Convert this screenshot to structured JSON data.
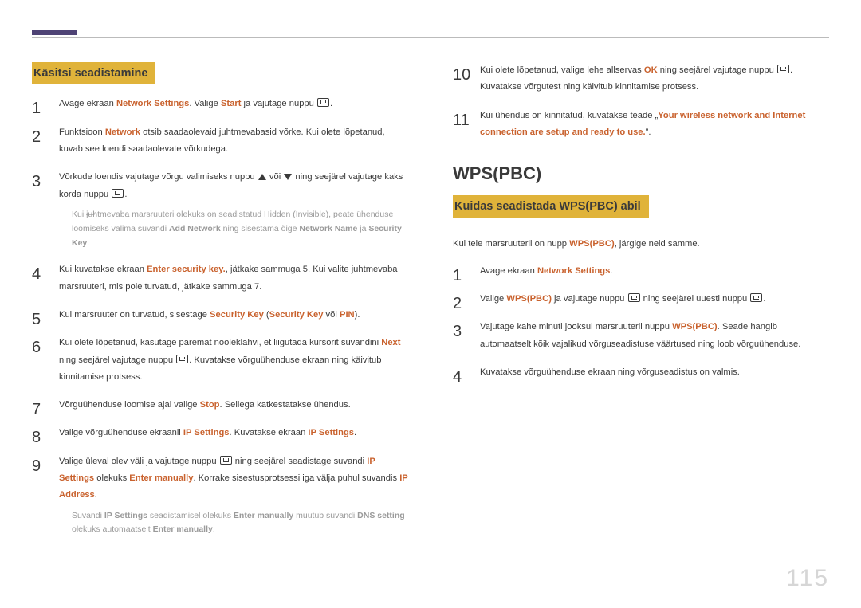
{
  "page_number": "115",
  "left": {
    "section_title": "Käsitsi seadistamine",
    "steps": {
      "s1_a": "Avage ekraan ",
      "s1_b": "Network Settings",
      "s1_c": ". Valige ",
      "s1_d": "Start",
      "s1_e": " ja vajutage nuppu ",
      "s1_f": ".",
      "s2_a": "Funktsioon ",
      "s2_b": "Network",
      "s2_c": " otsib saadaolevaid juhtmevabasid võrke. Kui olete lõpetanud, kuvab see loendi saadaolevate võrkudega.",
      "s3_a": "Võrkude loendis vajutage võrgu valimiseks nuppu ",
      "s3_b": " või ",
      "s3_c": " ning seejärel vajutage kaks korda nuppu ",
      "s3_d": ".",
      "note1_a": "Kui juhtmevaba marsruuteri olekuks on seadistatud Hidden (Invisible), peate ühenduse loomiseks valima suvandi ",
      "note1_b": "Add Network",
      "note1_c": " ning sisestama õige ",
      "note1_d": "Network Name",
      "note1_e": " ja ",
      "note1_f": "Security Key",
      "note1_g": ".",
      "s4_a": "Kui kuvatakse ekraan ",
      "s4_b": "Enter security key.",
      "s4_c": ", jätkake sammuga 5. Kui valite juhtmevaba marsruuteri, mis pole turvatud, jätkake sammuga 7.",
      "s5_a": "Kui marsruuter on turvatud, sisestage ",
      "s5_b": "Security Key",
      "s5_c": " (",
      "s5_d": "Security Key",
      "s5_e": " või ",
      "s5_f": "PIN",
      "s5_g": ").",
      "s6_a": "Kui olete lõpetanud, kasutage paremat nooleklahvi, et liigutada kursorit suvandini ",
      "s6_b": "Next",
      "s6_c": " ning seejärel vajutage nuppu ",
      "s6_d": ". Kuvatakse võrguühenduse ekraan ning käivitub kinnitamise protsess.",
      "s7_a": "Võrguühenduse loomise ajal valige ",
      "s7_b": "Stop",
      "s7_c": ". Sellega katkestatakse ühendus.",
      "s8_a": "Valige võrguühenduse ekraanil ",
      "s8_b": "IP Settings",
      "s8_c": ". Kuvatakse ekraan ",
      "s8_d": "IP Settings",
      "s8_e": ".",
      "s9_a": "Valige üleval olev väli ja vajutage nuppu ",
      "s9_b": " ning seejärel seadistage suvandi ",
      "s9_c": "IP Settings",
      "s9_d": " olekuks ",
      "s9_e": "Enter manually",
      "s9_f": ". Korrake sisestusprotsessi iga välja puhul suvandis ",
      "s9_g": "IP Address",
      "s9_h": ".",
      "note2_a": "Suvandi ",
      "note2_b": "IP Settings",
      "note2_c": " seadistamisel olekuks ",
      "note2_d": "Enter manually",
      "note2_e": " muutub suvandi ",
      "note2_f": "DNS setting",
      "note2_g": " olekuks automaatselt ",
      "note2_h": "Enter manually",
      "note2_i": "."
    }
  },
  "right": {
    "cont": {
      "s10_a": "Kui olete lõpetanud, valige lehe allservas ",
      "s10_b": "OK",
      "s10_c": " ning seejärel vajutage nuppu ",
      "s10_d": ". Kuvatakse võrgutest ning käivitub kinnitamise protsess.",
      "s11_a": "Kui ühendus on kinnitatud, kuvatakse teade „",
      "s11_b": "Your wireless network and Internet connection are setup and ready to use.",
      "s11_c": "”."
    },
    "h1": "WPS(PBC)",
    "section_title": "Kuidas seadistada WPS(PBC) abil",
    "intro_a": "Kui teie marsruuteril on nupp ",
    "intro_b": "WPS(PBC)",
    "intro_c": ", järgige neid samme.",
    "steps": {
      "s1_a": "Avage ekraan ",
      "s1_b": "Network Settings",
      "s1_c": ".",
      "s2_a": "Valige ",
      "s2_b": "WPS(PBC)",
      "s2_c": " ja vajutage nuppu ",
      "s2_d": " ning seejärel uuesti nuppu ",
      "s2_e": ".",
      "s3_a": "Vajutage kahe minuti jooksul marsruuteril nuppu ",
      "s3_b": "WPS(PBC)",
      "s3_c": ". Seade hangib automaatselt kõik vajalikud võrguseadistuse väärtused ning loob võrguühenduse.",
      "s4_a": "Kuvatakse võrguühenduse ekraan ning võrguseadistus on valmis."
    }
  }
}
